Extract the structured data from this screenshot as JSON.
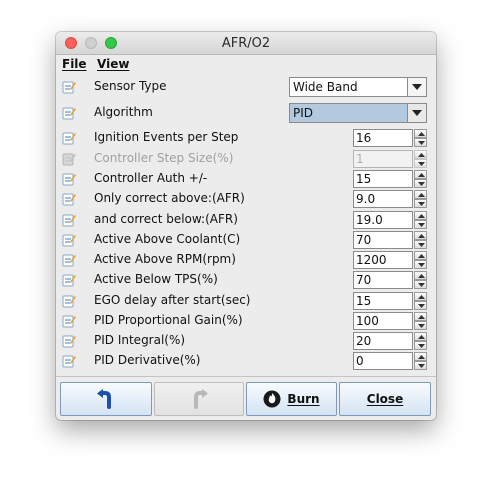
{
  "window": {
    "title": "AFR/O2"
  },
  "menu": {
    "file": "File",
    "view": "View"
  },
  "fields": [
    {
      "label": "Sensor Type",
      "kind": "select",
      "value": "Wide Band",
      "enabled": true
    },
    {
      "label": "Algorithm",
      "kind": "select",
      "value": "PID",
      "enabled": true,
      "highlighted": true
    },
    {
      "label": "Ignition Events per Step",
      "kind": "spinner",
      "value": "16",
      "enabled": true
    },
    {
      "label": "Controller Step Size(%)",
      "kind": "spinner",
      "value": "1",
      "enabled": false
    },
    {
      "label": "Controller Auth +/-",
      "kind": "spinner",
      "value": "15",
      "enabled": true
    },
    {
      "label": "Only correct above:(AFR)",
      "kind": "spinner",
      "value": "9.0",
      "enabled": true
    },
    {
      "label": "and correct below:(AFR)",
      "kind": "spinner",
      "value": "19.0",
      "enabled": true
    },
    {
      "label": "Active Above Coolant(C)",
      "kind": "spinner",
      "value": "70",
      "enabled": true
    },
    {
      "label": "Active Above RPM(rpm)",
      "kind": "spinner",
      "value": "1200",
      "enabled": true
    },
    {
      "label": "Active Below TPS(%)",
      "kind": "spinner",
      "value": "70",
      "enabled": true
    },
    {
      "label": "EGO delay after start(sec)",
      "kind": "spinner",
      "value": "15",
      "enabled": true
    },
    {
      "label": "PID Proportional Gain(%)",
      "kind": "spinner",
      "value": "100",
      "enabled": true
    },
    {
      "label": "PID Integral(%)",
      "kind": "spinner",
      "value": "20",
      "enabled": true
    },
    {
      "label": "PID Derivative(%)",
      "kind": "spinner",
      "value": "0",
      "enabled": true
    }
  ],
  "buttons": {
    "undo": {
      "icon": "undo-arrow-icon",
      "enabled": true
    },
    "redo": {
      "icon": "redo-arrow-icon",
      "enabled": false
    },
    "burn": {
      "label": "Burn",
      "icon": "flame-icon",
      "enabled": true
    },
    "close": {
      "label": "Close",
      "enabled": true
    }
  },
  "colors": {
    "select_highlight": "#b3c9e0",
    "button_border": "#7f99b8",
    "help_icon_blue": "#3d7fd1"
  }
}
